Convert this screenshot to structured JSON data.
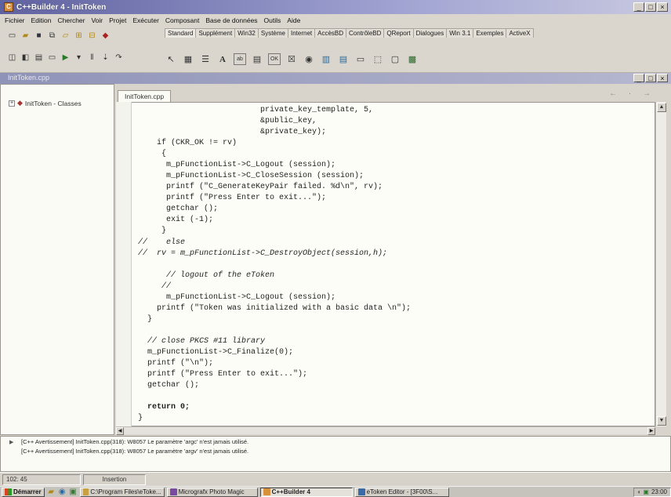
{
  "window": {
    "title": "C++Builder 4 - InitToken",
    "controls": [
      "_",
      "□",
      "×"
    ]
  },
  "menu": [
    "Fichier",
    "Edition",
    "Chercher",
    "Voir",
    "Projet",
    "Exécuter",
    "Composant",
    "Base de données",
    "Outils",
    "Aide"
  ],
  "palette": {
    "tabs": [
      "Standard",
      "Supplément",
      "Win32",
      "Système",
      "Internet",
      "AccèsBD",
      "ContrôleBD",
      "QReport",
      "Dialogues",
      "Win 3.1",
      "Exemples",
      "ActiveX"
    ],
    "active_tab": "Standard",
    "icons": [
      "pointer-icon",
      "frames-icon",
      "mainmenu-icon",
      "label-icon",
      "edit-icon",
      "memo-icon",
      "button-icon",
      "checkbox-icon",
      "radiobutton-icon",
      "listbox-icon",
      "combobox-icon",
      "scrollbar-icon",
      "groupbox-icon",
      "radiogroup-icon",
      "panel-icon"
    ]
  },
  "panel": {
    "title": "InitToken.cpp",
    "controls": [
      "_",
      "□",
      "×"
    ]
  },
  "class_tree": {
    "item": "InitToken - Classes"
  },
  "editor": {
    "tab": "InitToken.cpp",
    "nav": "← · →",
    "lines": [
      "                          private_key_template, 5,",
      "                          &public_key,",
      "                          &private_key);",
      "    if (CKR_OK != rv)",
      "     {",
      "      m_pFunctionList->C_Logout (session);",
      "      m_pFunctionList->C_CloseSession (session);",
      "      printf (\"C_GenerateKeyPair failed. %d\\n\", rv);",
      "      printf (\"Press Enter to exit...\");",
      "      getchar ();",
      "      exit (-1);",
      "     }",
      "//    else",
      "//  rv = m_pFunctionList->C_DestroyObject(session,h);",
      "      // logout of the eToken",
      "     //",
      "      m_pFunctionList->C_Logout (session);",
      "    printf (\"Token was initialized with a basic data \\n\");",
      "  }",
      "  // close PKCS #11 library",
      "  m_pFunctionList->C_Finalize(0);",
      "  printf (\"\\n\");",
      "  printf (\"Press Enter to exit...\");",
      "  getchar ();",
      "  return 0;",
      "}"
    ]
  },
  "messages": [
    "[C++ Avertissement] InitToken.cpp(318): W8057 Le paramètre 'argc' n'est jamais utilisé.",
    "[C++ Avertissement] InitToken.cpp(318): W8057 Le paramètre 'argv' n'est jamais utilisé."
  ],
  "status": {
    "position": "102: 45",
    "mode": "Insertion"
  },
  "taskbar": {
    "start": "Démarrer",
    "tasks": [
      "C:\\Program Files\\eToke...",
      "Micrografx Photo Magic",
      "C++Builder 4",
      "eToken Editor - [3F00\\S..."
    ],
    "active_task": "C++Builder 4",
    "clock": "23:00"
  },
  "colors": {
    "titlebar": "#5f62a0",
    "comment": "#1d2a7a",
    "editor_bg": "#fdfdf8"
  }
}
